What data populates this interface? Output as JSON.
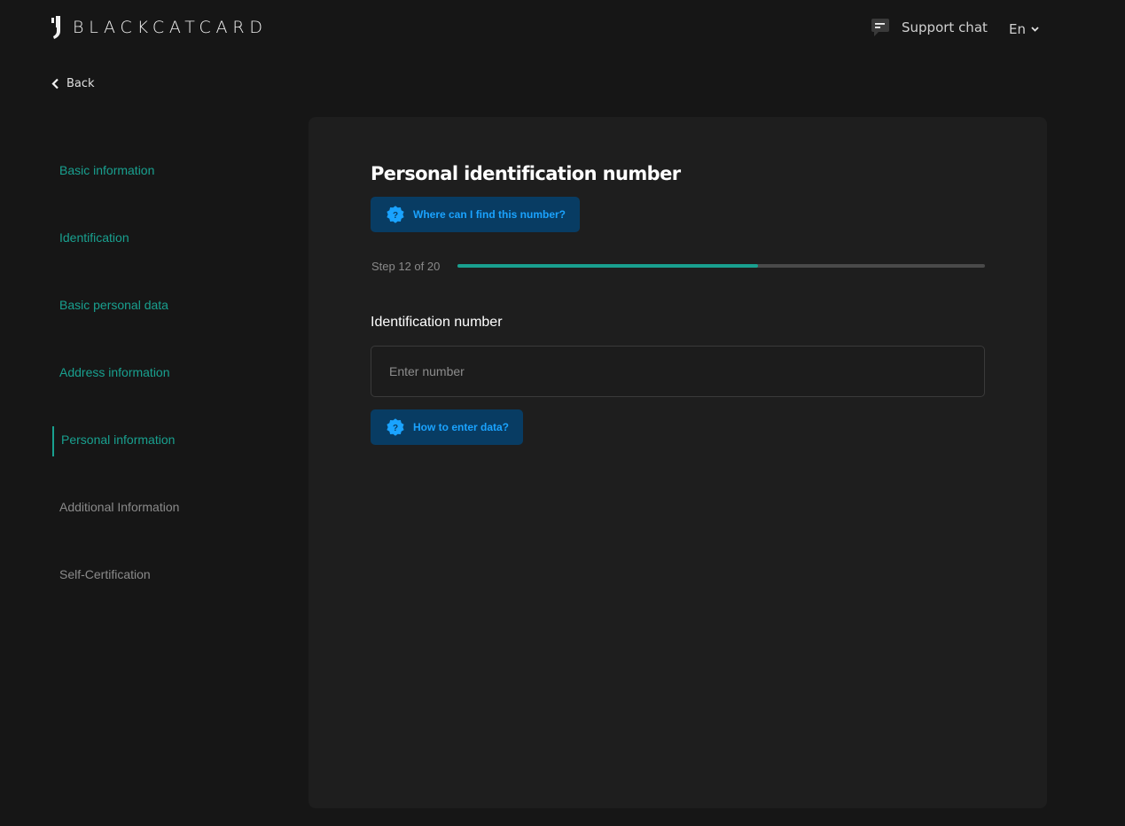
{
  "colors": {
    "background": "#161616",
    "card": "#1e1e1e",
    "accent": "#19a08f",
    "help_bg": "#083c63",
    "help_text": "#1aa3ff",
    "pending_text": "#8a8a8a"
  },
  "header": {
    "logo_text": "BLACKCATCARD",
    "logo_icon": "blackcat-mark-icon",
    "support_label": "Support chat",
    "support_icon": "chat-bubble-icon",
    "language": "En",
    "language_icon": "chevron-down-icon"
  },
  "nav": {
    "back_label": "Back",
    "back_icon": "chevron-left-icon"
  },
  "sidebar": {
    "items": [
      {
        "label": "Basic information",
        "state": "done"
      },
      {
        "label": "Identification",
        "state": "done"
      },
      {
        "label": "Basic personal data",
        "state": "done"
      },
      {
        "label": "Address information",
        "state": "done"
      },
      {
        "label": "Personal information",
        "state": "active"
      },
      {
        "label": "Additional Information",
        "state": "pending"
      },
      {
        "label": "Self-Certification",
        "state": "pending"
      }
    ]
  },
  "main": {
    "title": "Personal identification number",
    "help_top_label": "Where can I find this number?",
    "help_icon": "question-badge-icon",
    "step_text": "Step 12 of 20",
    "progress": {
      "current": 12,
      "total": 20,
      "fill_fraction": 0.57
    },
    "field_label": "Identification number",
    "input": {
      "value": "",
      "placeholder": "Enter number"
    },
    "help_bottom_label": "How to enter data?"
  }
}
